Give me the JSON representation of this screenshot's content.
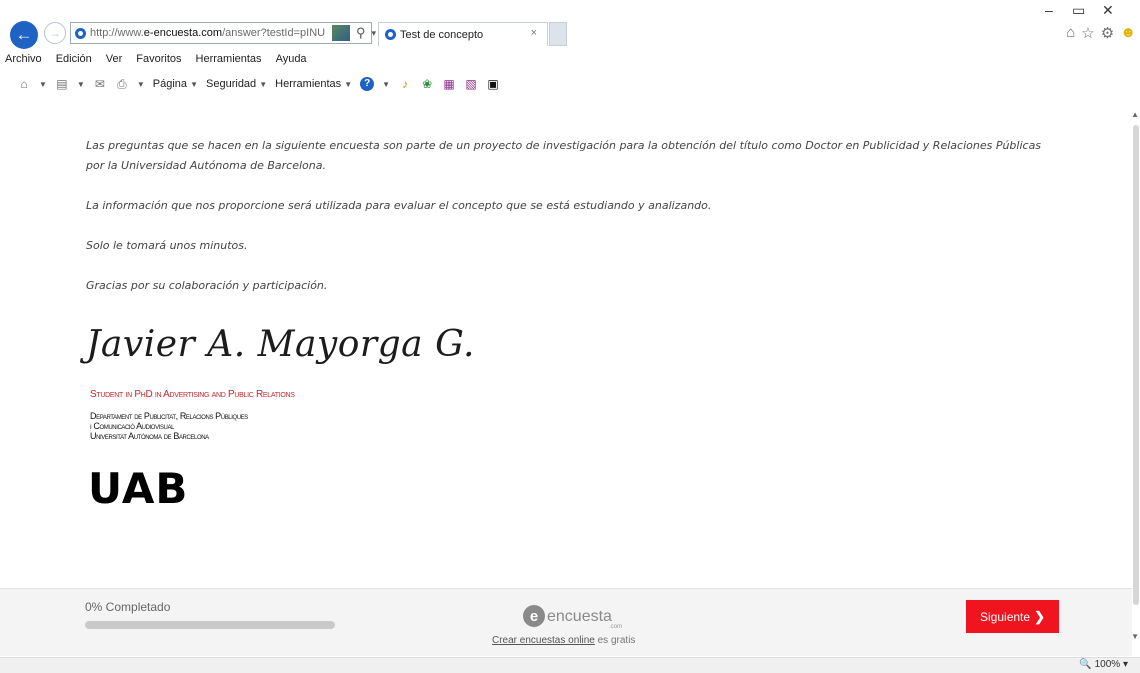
{
  "browser": {
    "url_prefix": "http://www.",
    "url_domain": "e-encuesta.com",
    "url_rest": "/answer?testId=pINU",
    "tab_title": "Test de concepto",
    "tab_close": "×",
    "window_controls": {
      "minimize": "–",
      "restore": "▭",
      "close": "✕"
    }
  },
  "menu": [
    "Archivo",
    "Edición",
    "Ver",
    "Favoritos",
    "Herramientas",
    "Ayuda"
  ],
  "command_bar": {
    "page": "Página",
    "security": "Seguridad",
    "tools": "Herramientas"
  },
  "content": {
    "paragraphs": [
      "Las preguntas que se hacen en la siguiente encuesta son parte de un proyecto de investigación para la obtención del título como Doctor en Publicidad y Relaciones Públicas por la Universidad Autónoma de Barcelona.",
      "La información que nos proporcione será utilizada para evaluar el concepto que se está estudiando y analizando.",
      "Solo le tomará unos minutos.",
      "Gracias por su colaboración y participación."
    ],
    "signature_name": "Javier A. Mayorga G.",
    "signature_role": "Student in PhD in Advertising and Public Relations",
    "department_lines": [
      "Departament de Publicitat, Relacions Públiques",
      "i Comunicació Audiovisual",
      "Universitat Autònoma de Barcelona"
    ],
    "university_logo": "UAB"
  },
  "footer": {
    "progress_label": "0% Completado",
    "progress_fraction": 0,
    "brand_letter": "e",
    "brand_name": "encuesta",
    "brand_suffix": ".com",
    "tagline_link": "Crear encuestas online",
    "tagline_rest": " es gratis",
    "next_button": "Siguiente",
    "next_arrow": "❯"
  },
  "status": {
    "zoom": "100%"
  },
  "colors": {
    "accent": "#f0141e",
    "browser_blue": "#1e63c4",
    "signature_red": "#c8272d"
  }
}
